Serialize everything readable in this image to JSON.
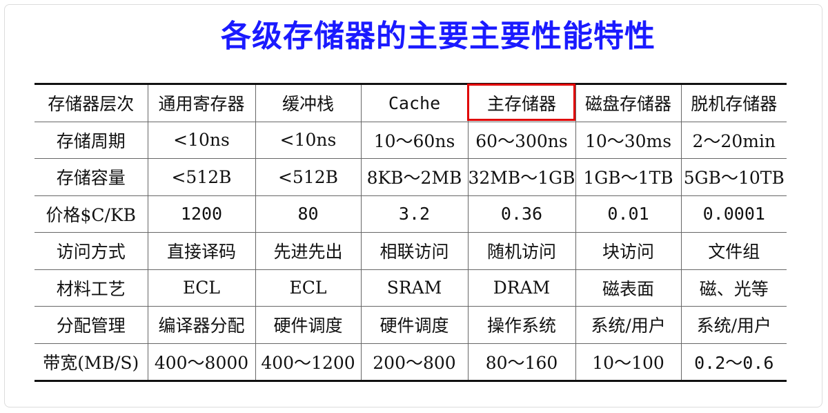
{
  "title": "各级存储器的主要主要性能特性",
  "header": [
    "存储器层次",
    "通用寄存器",
    "缓冲栈",
    "Cache",
    "主存储器",
    "磁盘存储器",
    "脱机存储器"
  ],
  "rows": [
    [
      "存储周期",
      "<10ns",
      "<10ns",
      "10～60ns",
      "60～300ns",
      "10～30ms",
      "2～20min"
    ],
    [
      "存储容量",
      "<512B",
      "<512B",
      "8KB～2MB",
      "32MB～1GB",
      "1GB～1TB",
      "5GB～10TB"
    ],
    [
      "价格$C/KB",
      "1200",
      "80",
      "3.2",
      "0.36",
      "0.01",
      "0.0001"
    ],
    [
      "访问方式",
      "直接译码",
      "先进先出",
      "相联访问",
      "随机访问",
      "块访问",
      "文件组"
    ],
    [
      "材料工艺",
      "ECL",
      "ECL",
      "SRAM",
      "DRAM",
      "磁表面",
      "磁、光等"
    ],
    [
      "分配管理",
      "编译器分配",
      "硬件调度",
      "硬件调度",
      "操作系统",
      "系统/用户",
      "系统/用户"
    ],
    [
      "带宽(MB/S)",
      "400～8000",
      "400～1200",
      "200～800",
      "80～160",
      "10～100",
      "0.2～0.6"
    ]
  ],
  "highlight_color": "#e00000",
  "title_color": "#1a1aff"
}
